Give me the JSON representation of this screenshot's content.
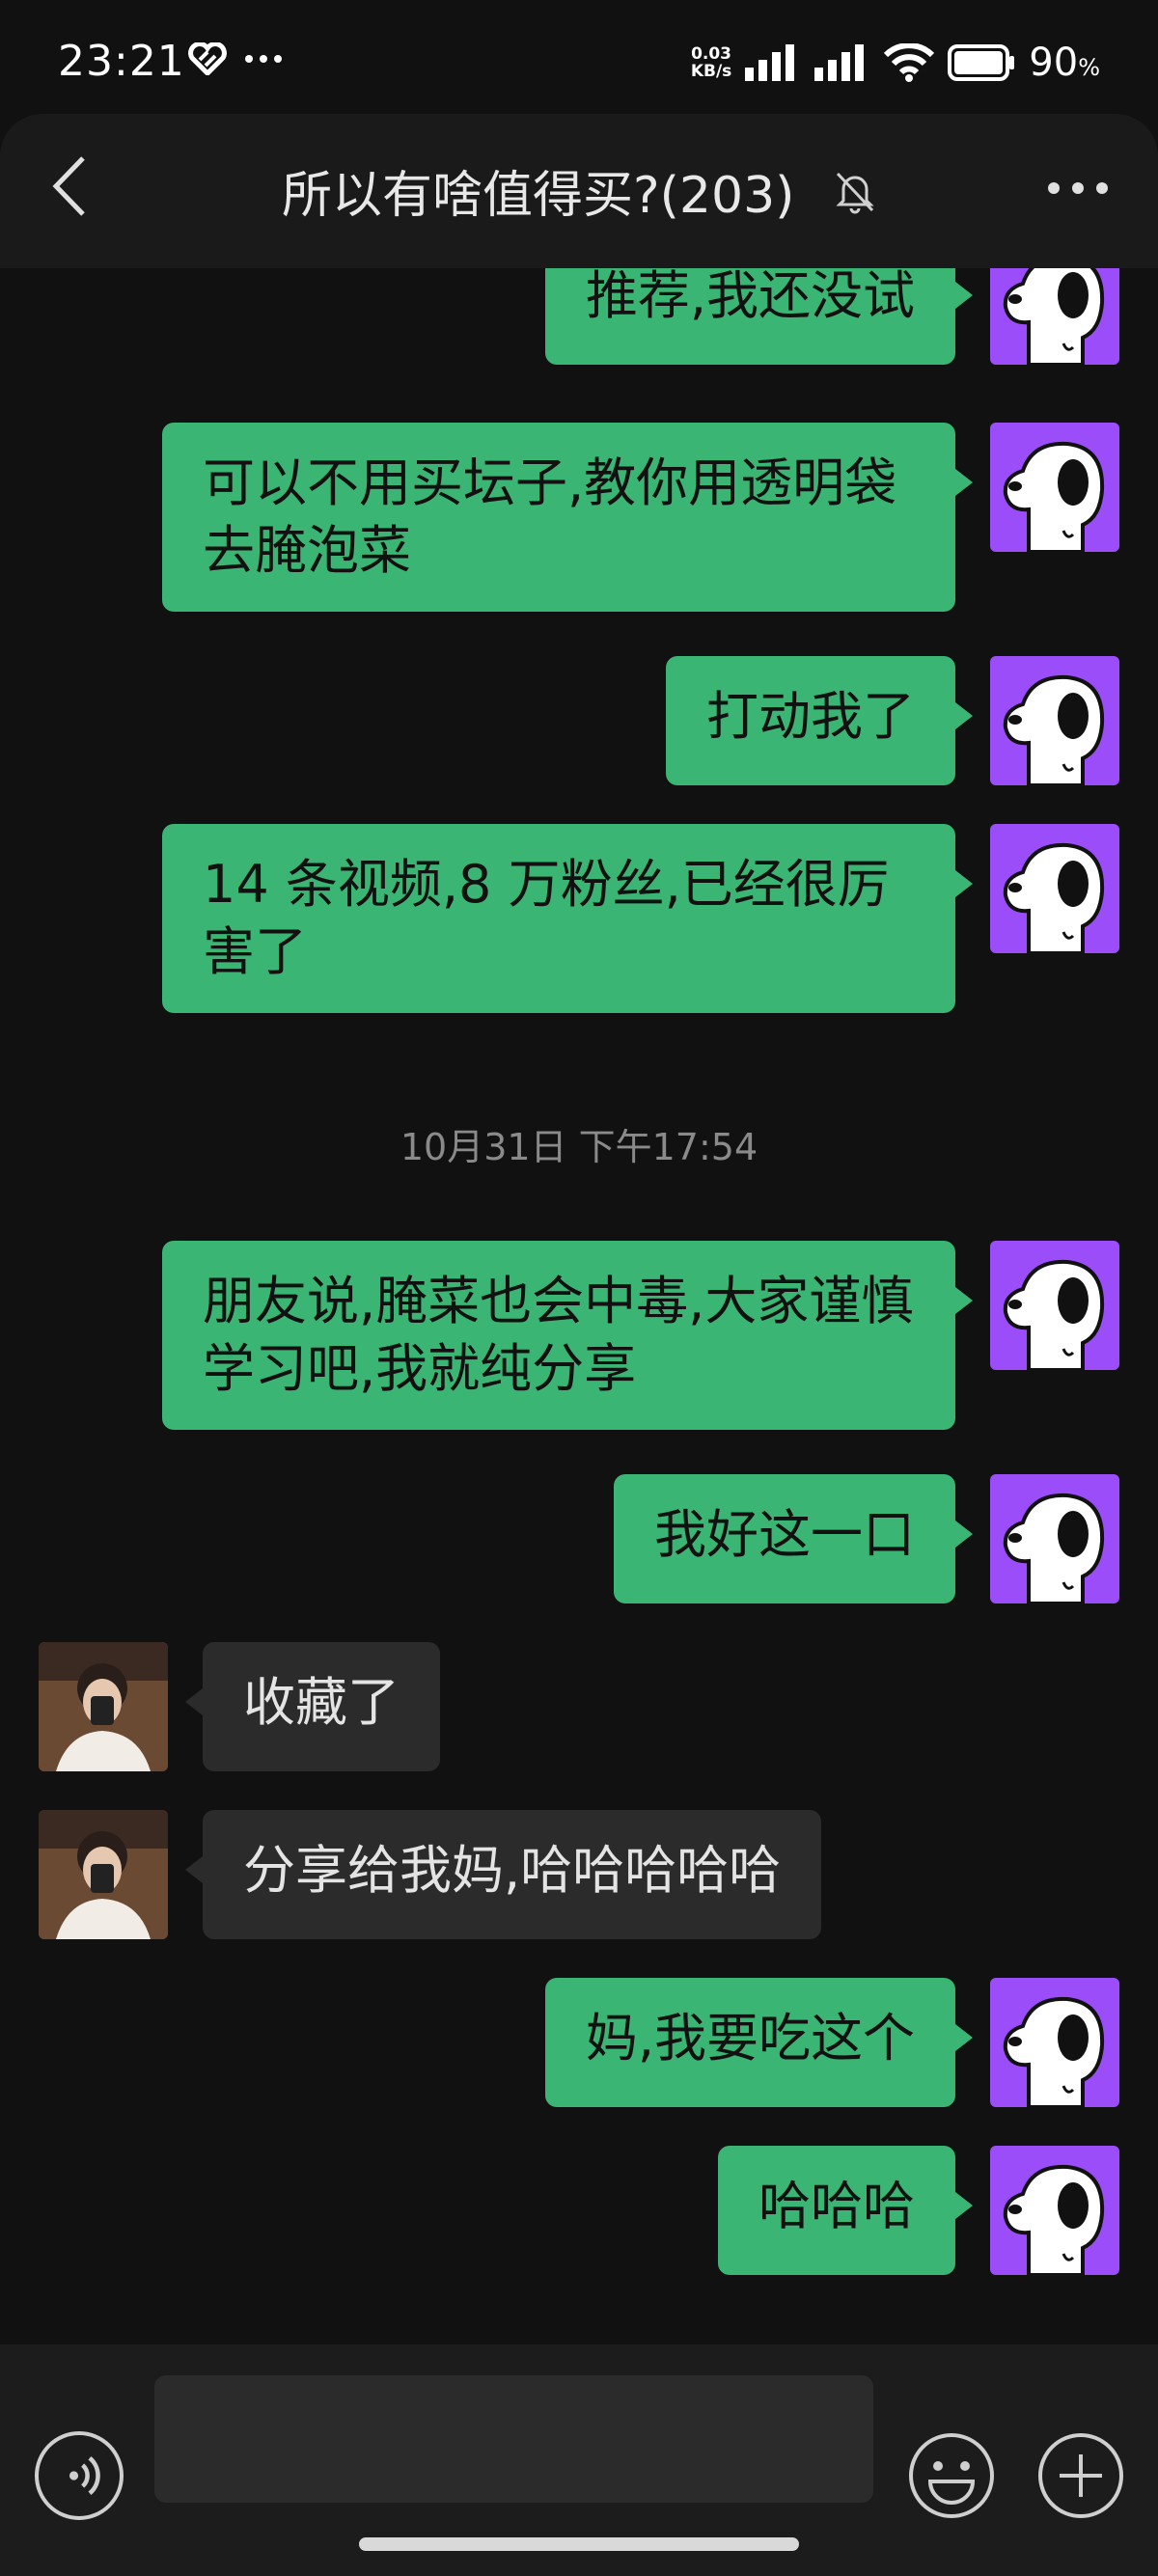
{
  "status_bar": {
    "time": "23:21",
    "net_speed_value": "0.03",
    "net_speed_unit": "KB/s",
    "battery": "90",
    "battery_unit": "%"
  },
  "header": {
    "title": "所以有啥值得买?(203)",
    "icons": [
      "back-arrow-icon",
      "mute-bell-icon",
      "more-dots-icon"
    ]
  },
  "messages": [
    {
      "side": "out",
      "text": "推荐,我还没试"
    },
    {
      "side": "out",
      "text": "可以不用买坛子,教你用透明袋去腌泡菜"
    },
    {
      "side": "out",
      "text": "打动我了"
    },
    {
      "side": "out",
      "text": "14 条视频,8 万粉丝,已经很厉害了"
    },
    {
      "side": "time",
      "text": "10月31日 下午17:54"
    },
    {
      "side": "out",
      "text": "朋友说,腌菜也会中毒,大家谨慎学习吧,我就纯分享"
    },
    {
      "side": "out",
      "text": "我好这一口"
    },
    {
      "side": "in",
      "text": "收藏了"
    },
    {
      "side": "in",
      "text": "分享给我妈,哈哈哈哈哈"
    },
    {
      "side": "out",
      "text": "妈,我要吃这个"
    },
    {
      "side": "out",
      "text": "哈哈哈"
    }
  ],
  "input_bar": {
    "icons": [
      "voice-icon",
      "emoji-icon",
      "plus-icon"
    ],
    "placeholder": ""
  },
  "colors": {
    "background": "#111111",
    "outgoing_bubble": "#3bb574",
    "incoming_bubble": "#2b2b2b",
    "avatar_purple": "#9b4dfa"
  }
}
